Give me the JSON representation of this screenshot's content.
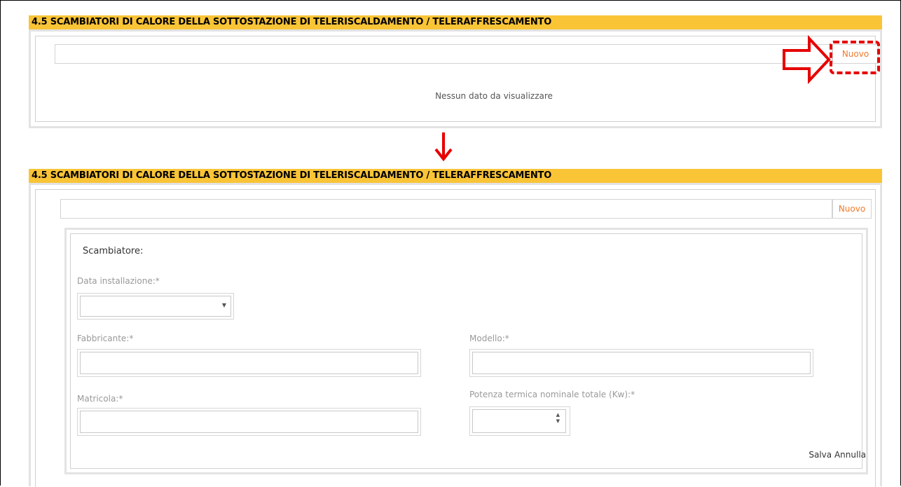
{
  "section1": {
    "title": "4.5 SCAMBIATORI DI CALORE DELLA SOTTOSTAZIONE DI TELERISCALDAMENTO / TELERAFFRESCAMENTO",
    "new_button": "Nuovo",
    "empty_message": "Nessun dato da visualizzare"
  },
  "section2": {
    "title": "4.5 SCAMBIATORI DI CALORE DELLA SOTTOSTAZIONE DI TELERISCALDAMENTO / TELERAFFRESCAMENTO",
    "new_button": "Nuovo",
    "form": {
      "heading": "Scambiatore:",
      "data_installazione_label": "Data installazione:*",
      "data_installazione_value": "",
      "fabbricante_label": "Fabbricante:*",
      "fabbricante_value": "",
      "modello_label": "Modello:*",
      "modello_value": "",
      "matricola_label": "Matricola:*",
      "matricola_value": "",
      "potenza_label": "Potenza termica nominale totale (Kw):*",
      "potenza_value": "",
      "save_button": "Salva",
      "cancel_button": "Annulla"
    }
  },
  "colors": {
    "header_bg": "#f9c436",
    "accent_orange": "#f07a2a",
    "annotation_red": "#e60000"
  },
  "icons": {
    "arrow_right": "red-outline-arrow-right-icon",
    "arrow_down": "red-arrow-down-icon",
    "dropdown": "caret-down-icon",
    "spinner": "spinner-icon"
  }
}
